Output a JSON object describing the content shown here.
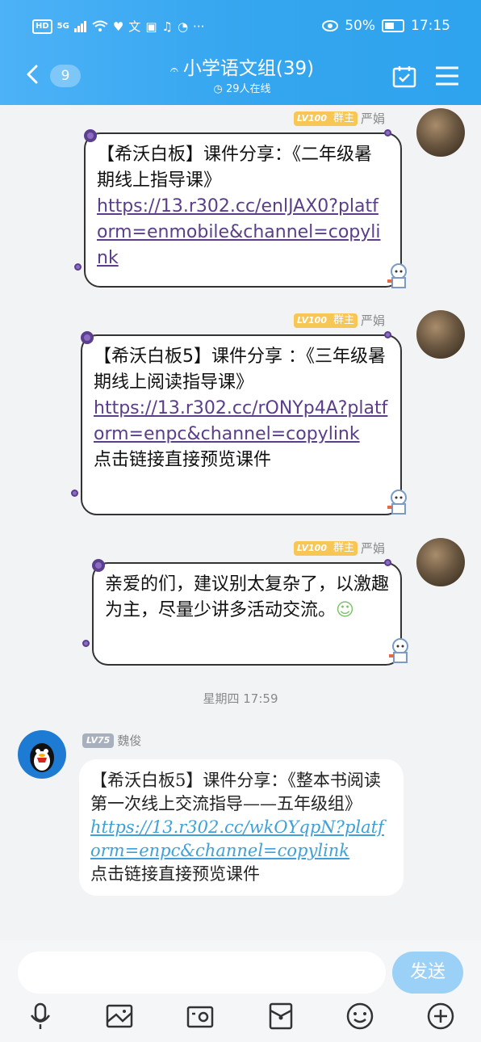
{
  "status_bar": {
    "network": "HD",
    "signal": "5G",
    "eye_pct": "50%",
    "time": "17:15"
  },
  "header": {
    "back_count": "9",
    "title": "小学语文组(39)",
    "online": "29人在线"
  },
  "messages": [
    {
      "sender": "严娟",
      "level": "LV100",
      "role": "群主",
      "text": "【希沃白板】课件分享：《二年级暑期线上指导课》",
      "link": "https://13.r302.cc/enlJAX0?platform=enmobile&channel=copylink",
      "footer": ""
    },
    {
      "sender": "严娟",
      "level": "LV100",
      "role": "群主",
      "text": "【希沃白板5】课件分享 ：《三年级暑期线上阅读指导课》",
      "link": "https://13.r302.cc/rONYp4A?platform=enpc&channel=copylink",
      "footer": "点击链接直接预览课件"
    },
    {
      "sender": "严娟",
      "level": "LV100",
      "role": "群主",
      "text": "亲爱的们，建议别太复杂了，以激趣为主，尽量少讲多活动交流。",
      "link": "",
      "footer": ""
    }
  ],
  "timestamp": "星期四 17:59",
  "message_other": {
    "sender": "魏俊",
    "level": "LV75",
    "text": "【希沃白板5】课件分享：《整本书阅读第一次线上交流指导——五年级组》",
    "link": "https://13.r302.cc/wkOYqpN?platform=enpc&channel=copylink",
    "footer": "点击链接直接预览课件"
  },
  "input": {
    "send_label": "发送"
  },
  "toolbar": [
    "mic-icon",
    "image-icon",
    "camera-icon",
    "red-packet-icon",
    "emoji-icon",
    "plus-icon"
  ],
  "colors": {
    "header": "#35a6ef",
    "link_purple": "#5a3e8a",
    "link_blue": "#3fa0d8",
    "send": "#9cd1f7"
  }
}
